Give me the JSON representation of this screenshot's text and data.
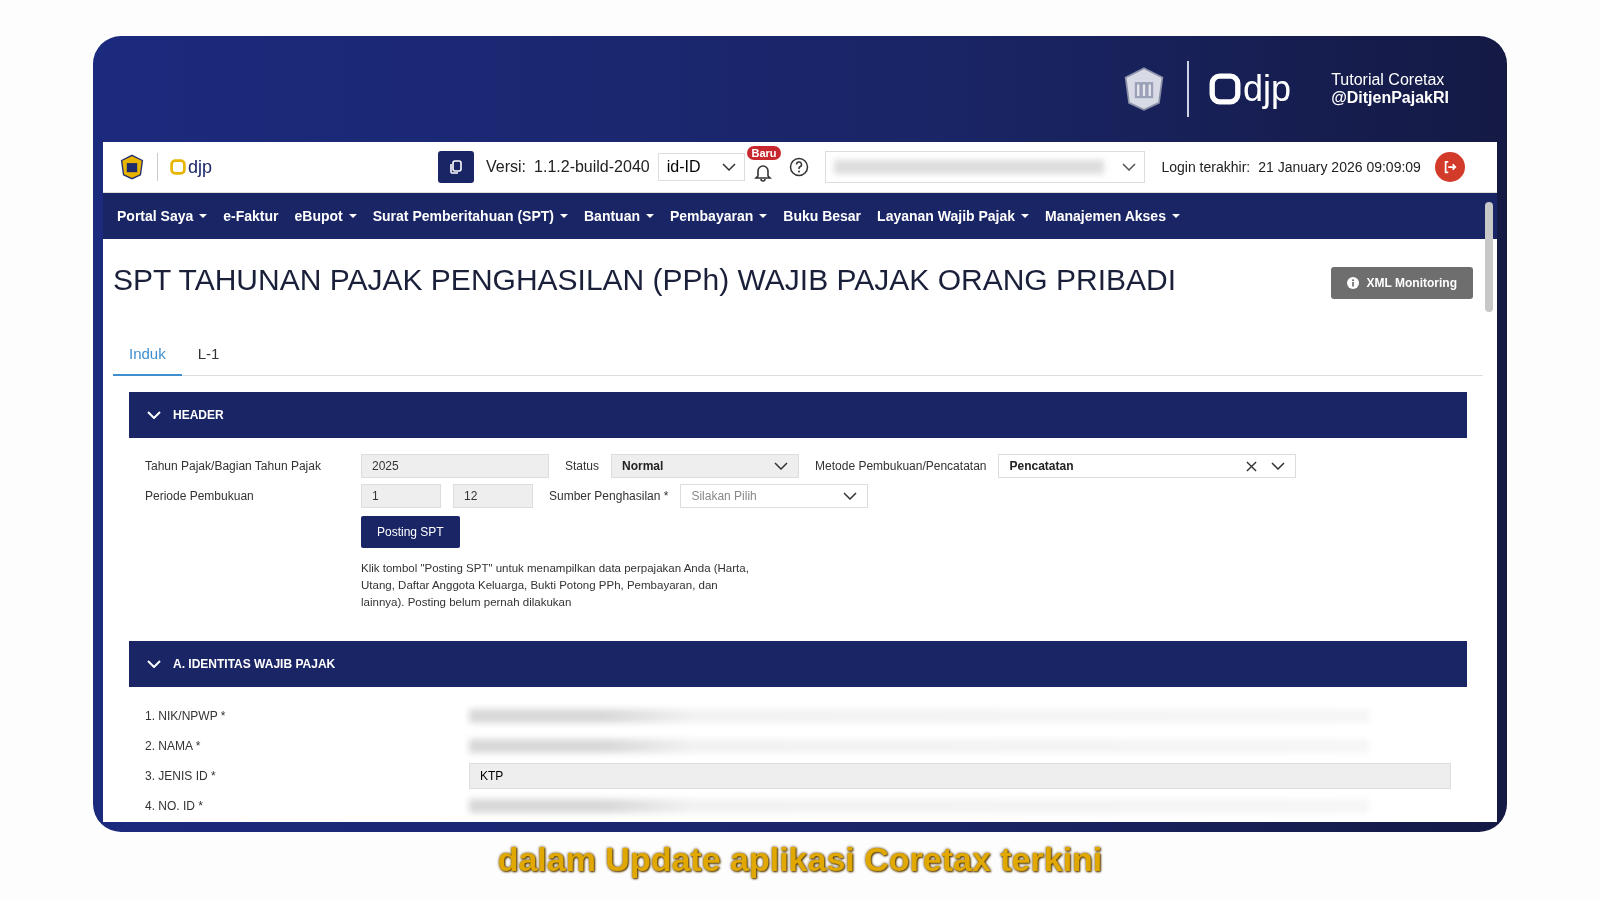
{
  "brand": {
    "logo_text": "djp",
    "tutorial": "Tutorial Coretax",
    "handle": "@DitjenPajakRI"
  },
  "toolbar": {
    "logo_text": "djp",
    "version_label": "Versi:",
    "version": "1.1.2-build-2040",
    "language": "id-ID",
    "badge": "Baru",
    "login_label": "Login terakhir:",
    "login_time": "21 January 2026 09:09:09"
  },
  "nav": [
    {
      "label": "Portal Saya",
      "dropdown": true
    },
    {
      "label": "e-Faktur",
      "dropdown": false
    },
    {
      "label": "eBupot",
      "dropdown": true
    },
    {
      "label": "Surat Pemberitahuan (SPT)",
      "dropdown": true
    },
    {
      "label": "Bantuan",
      "dropdown": true
    },
    {
      "label": "Pembayaran",
      "dropdown": true
    },
    {
      "label": "Buku Besar",
      "dropdown": false
    },
    {
      "label": "Layanan Wajib Pajak",
      "dropdown": true
    },
    {
      "label": "Manajemen Akses",
      "dropdown": true
    }
  ],
  "page_title": "SPT TAHUNAN PAJAK PENGHASILAN (PPh) WAJIB PAJAK ORANG PRIBADI",
  "xml_button": "XML Monitoring",
  "tabs": [
    {
      "label": "Induk",
      "selected": true
    },
    {
      "label": "L-1",
      "selected": false
    }
  ],
  "header_section": {
    "title": "HEADER",
    "expanded": true,
    "tahun_label": "Tahun Pajak/Bagian Tahun Pajak",
    "tahun_value": "2025",
    "status_label": "Status",
    "status_value": "Normal",
    "metode_label": "Metode Pembukuan/Pencatatan",
    "metode_value": "Pencatatan",
    "periode_label": "Periode Pembukuan",
    "periode_from": "1",
    "periode_to": "12",
    "sumber_label": "Sumber Penghasilan *",
    "sumber_placeholder": "Silakan Pilih",
    "posting_button": "Posting SPT",
    "note": "Klik tombol \"Posting SPT\" untuk menampilkan data perpajakan Anda (Harta, Utang, Daftar Anggota Keluarga, Bukti Potong PPh, Pembayaran, dan lainnya). Posting belum pernah dilakukan"
  },
  "identitas_section": {
    "title": "A. IDENTITAS WAJIB PAJAK",
    "expanded": true,
    "rows": [
      {
        "label": "1. NIK/NPWP *",
        "redacted": true
      },
      {
        "label": "2. NAMA *",
        "redacted": true
      },
      {
        "label": "3. JENIS ID *",
        "redacted": false,
        "value": "KTP"
      },
      {
        "label": "4. NO. ID *",
        "redacted": true
      }
    ]
  },
  "caption": "dalam Update aplikasi Coretax terkini"
}
